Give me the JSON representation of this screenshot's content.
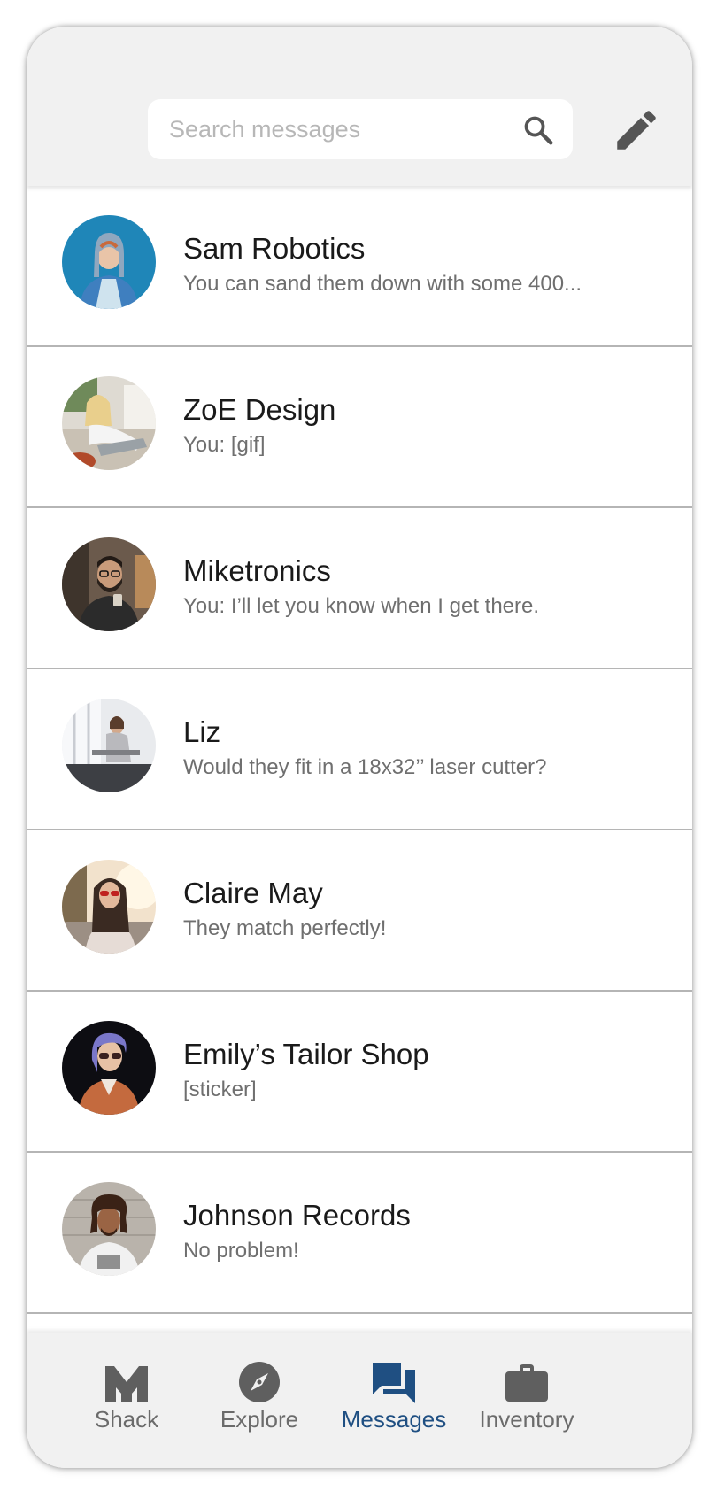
{
  "search": {
    "placeholder": "Search messages",
    "value": ""
  },
  "conversations": [
    {
      "name": "Sam Robotics",
      "preview": "You can sand them down with some 400...",
      "avatar": "woman-denim-jacket-avatar"
    },
    {
      "name": "ZoE Design",
      "preview": "You: [gif]",
      "avatar": "woman-on-sofa-avatar"
    },
    {
      "name": "Miketronics",
      "preview": "You: I’ll let you know when I get there.",
      "avatar": "bearded-man-avatar"
    },
    {
      "name": "Liz",
      "preview": "Would they fit in a 18x32’’ laser cutter?",
      "avatar": "woman-by-window-avatar"
    },
    {
      "name": "Claire May",
      "preview": "They match perfectly!",
      "avatar": "woman-sunglasses-avatar"
    },
    {
      "name": "Emily’s Tailor Shop",
      "preview": "[sticker]",
      "avatar": "purple-hair-woman-avatar"
    },
    {
      "name": "Johnson Records",
      "preview": "No problem!",
      "avatar": "curly-hair-man-avatar"
    }
  ],
  "nav": {
    "items": [
      {
        "label": "Shack",
        "icon": "shack-icon",
        "active": false
      },
      {
        "label": "Explore",
        "icon": "compass-icon",
        "active": false
      },
      {
        "label": "Messages",
        "icon": "chat-bubbles-icon",
        "active": true
      },
      {
        "label": "Inventory",
        "icon": "briefcase-icon",
        "active": false
      }
    ]
  },
  "colors": {
    "accent": "#1f4f82",
    "bar_background": "#f1f1f1",
    "icon_gray": "#5f5f5f",
    "divider": "#b5b5b5"
  }
}
